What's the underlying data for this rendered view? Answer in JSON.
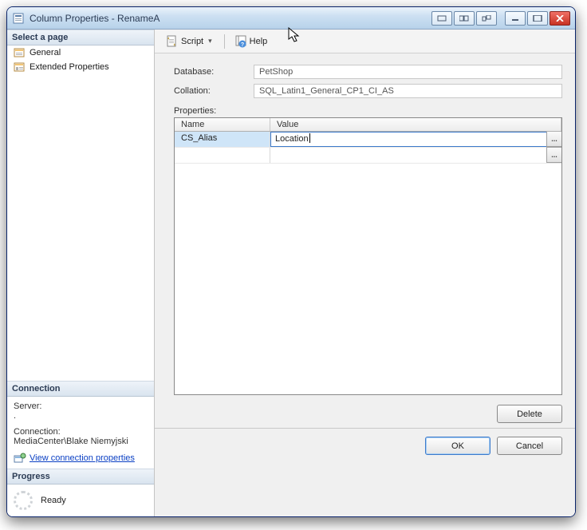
{
  "window": {
    "title": "Column Properties - RenameA"
  },
  "sidebar": {
    "select_page_header": "Select a page",
    "pages": [
      {
        "label": "General"
      },
      {
        "label": "Extended Properties"
      }
    ],
    "connection_header": "Connection",
    "server_label": "Server:",
    "server_value": ".",
    "connection_label": "Connection:",
    "connection_value": "MediaCenter\\Blake Niemyjski",
    "view_connection_link": "View connection properties",
    "progress_header": "Progress",
    "progress_status": "Ready"
  },
  "toolbar": {
    "script_label": "Script",
    "help_label": "Help"
  },
  "form": {
    "database_label": "Database:",
    "database_value": "PetShop",
    "collation_label": "Collation:",
    "collation_value": "SQL_Latin1_General_CP1_CI_AS",
    "properties_label": "Properties:",
    "columns": {
      "name": "Name",
      "value": "Value"
    },
    "rows": [
      {
        "name": "CS_Alias",
        "value": "Location"
      }
    ],
    "ellipsis": "..."
  },
  "buttons": {
    "delete": "Delete",
    "ok": "OK",
    "cancel": "Cancel"
  }
}
